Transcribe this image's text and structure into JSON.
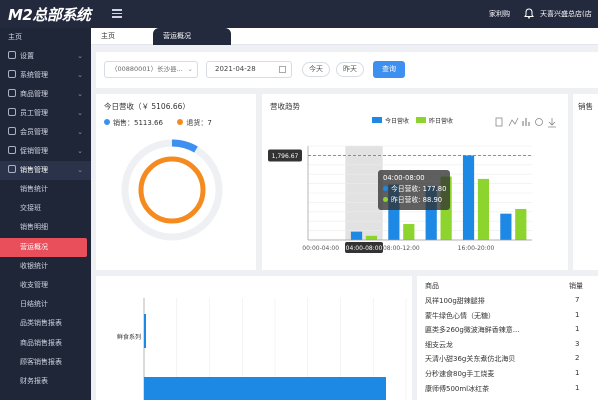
{
  "app": {
    "title": "M2总部系统",
    "header": {
      "user_label": "家利购",
      "store_label": "天喜兴盛总店(店"
    }
  },
  "sidebar": {
    "home_label": "主页",
    "groups": [
      {
        "label": "设置",
        "icon": "gear-icon"
      },
      {
        "label": "系统管理",
        "icon": "grid-icon"
      },
      {
        "label": "商品管理",
        "icon": "box-icon"
      },
      {
        "label": "员工管理",
        "icon": "user-icon"
      },
      {
        "label": "会员管理",
        "icon": "member-icon"
      },
      {
        "label": "促销管理",
        "icon": "promo-icon"
      },
      {
        "label": "销售管理",
        "icon": "sales-icon"
      }
    ],
    "sub_items": [
      "销售统计",
      "交接班",
      "销售明细",
      "营运概况",
      "收银统计",
      "收支管理",
      "日结统计",
      "品类销售报表",
      "商品销售报表",
      "顾客销售报表",
      "财务报表"
    ],
    "active_sub": "营运概况"
  },
  "tabs": [
    {
      "label": "主页",
      "active": false
    },
    {
      "label": "营运概况",
      "active": true
    }
  ],
  "filters": {
    "store": "（00880001）长沙县...",
    "date": "2021-04-28",
    "today_label": "今天",
    "yesterday_label": "昨天",
    "query_label": "查询"
  },
  "revenue_card": {
    "title": "今日营收（￥ 5106.66）",
    "sales_label": "销售：5113.66",
    "refund_label": "退货：7",
    "sales_color": "#3d8ff0",
    "refund_color": "#f58a1f"
  },
  "trend_card": {
    "title": "营收趋势",
    "tooltip": {
      "time": "04:00-08:00",
      "today": "今日营收: 177.80",
      "yesterday": "昨日营收: 88.90"
    },
    "pointer_value": "1,796.67",
    "axis_pointer_label": "04:00-08:00"
  },
  "right_partial_card": {
    "title": "销售"
  },
  "bottom_chart": {
    "category_label": "鲜食系列"
  },
  "product_table": {
    "headers": [
      "商品",
      "销量"
    ],
    "rows": [
      {
        "name": "风祥100g甜辣腿排",
        "qty": "7"
      },
      {
        "name": "蒙牛绿色心情（无糖）",
        "qty": "1"
      },
      {
        "name": "匾类多260g微波海鲜香辣意...",
        "qty": "1"
      },
      {
        "name": "细支云龙",
        "qty": "3"
      },
      {
        "name": "天清小甜36g关东煮仿北海贝",
        "qty": "2"
      },
      {
        "name": "分秒速食80g手工烧麦",
        "qty": "1"
      },
      {
        "name": "康师傅500ml冰红茶",
        "qty": "1"
      }
    ]
  },
  "chart_data": [
    {
      "type": "bar",
      "title": "营收趋势",
      "categories": [
        "00:00-04:00",
        "04:00-08:00",
        "08:00-12:00",
        "12:00-16:00",
        "16:00-20:00",
        "20:00-24:00"
      ],
      "series": [
        {
          "name": "今日营收",
          "color": "#1e88e5",
          "values": [
            0,
            177.8,
            1180,
            1150,
            1796.67,
            560
          ]
        },
        {
          "name": "昨日营收",
          "color": "#8ed42e",
          "values": [
            0,
            88.9,
            340,
            1350,
            1300,
            660
          ]
        }
      ],
      "xticks": [
        "00:00-04:00",
        "08:00-12:00",
        "16:00-20:00"
      ],
      "ylim": [
        0,
        2000
      ],
      "grid": true,
      "legend": "top"
    },
    {
      "type": "bar",
      "orientation": "horizontal",
      "categories": [
        "鲜食系列"
      ],
      "values": [
        5113.66
      ],
      "series_color": "#1e88e5"
    }
  ]
}
